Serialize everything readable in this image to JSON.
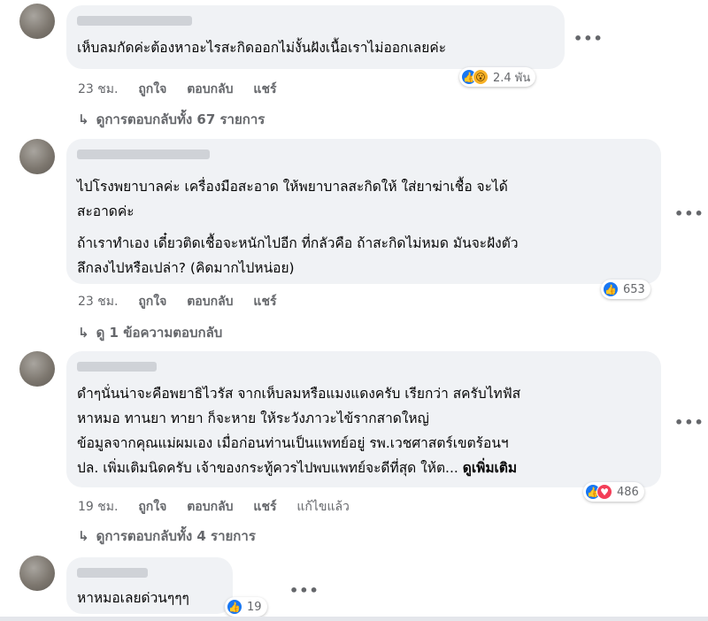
{
  "comments": [
    {
      "text_lines": [
        "เห็บลมกัดค่ะต้องหาอะไรสะกิดออกไม่งั้นฝังเนื้อเราไม่ออกเลยค่ะ"
      ],
      "time": "23 ชม.",
      "like_label": "ถูกใจ",
      "reply_label": "ตอบกลับ",
      "share_label": "แชร์",
      "reaction_count": "2.4 พัน",
      "reactions": [
        "like-icon",
        "wow-icon"
      ],
      "replies_label": "ดูการตอบกลับทั้ง 67 รายการ"
    },
    {
      "text_lines": [
        "ไปโรงพยาบาลค่ะ เครื่องมือสะอาด ให้พยาบาลสะกิดให้ ใส่ยาฆ่าเชื้อ จะได้",
        "สะอาดค่ะ",
        "ถ้าเราทำเอง เดี๋ยวติดเชื้อจะหนักไปอีก ที่กลัวคือ ถ้าสะกิดไม่หมด มันจะฝังตัว",
        "ลึกลงไปหรือเปล่า? (คิดมากไปหน่อย)"
      ],
      "time": "23 ชม.",
      "like_label": "ถูกใจ",
      "reply_label": "ตอบกลับ",
      "share_label": "แชร์",
      "reaction_count": "653",
      "reactions": [
        "like-icon"
      ],
      "replies_label": "ดู 1 ข้อความตอบกลับ"
    },
    {
      "text_lines": [
        "ดำๆนั่นน่าจะคือพยาธิไวรัส จากเห็บลมหรือแมงแดงครับ เรียกว่า สครับไทฟัส",
        "หาหมอ ทานยา ทายา ก็จะหาย ให้ระวังภาวะไข้รากสาดใหญ่",
        "ข้อมูลจากคุณแม่ผมเอง เมื่อก่อนท่านเป็นแพทย์อยู่ รพ.เวชศาสตร์เขตร้อนฯ",
        "ปล. เพิ่มเติมนิดครับ เจ้าของกระทู้ควรไปพบแพทย์จะดีที่สุด ให้ต..."
      ],
      "see_more": "ดูเพิ่มเติม",
      "time": "19 ชม.",
      "like_label": "ถูกใจ",
      "reply_label": "ตอบกลับ",
      "share_label": "แชร์",
      "edited_label": "แก้ไขแล้ว",
      "reaction_count": "486",
      "reactions": [
        "like-icon",
        "love-icon"
      ],
      "replies_label": "ดูการตอบกลับทั้ง 4 รายการ"
    },
    {
      "text_lines": [
        "หาหมอเลยด่วนๆๆๆ"
      ],
      "reaction_count": "19",
      "reactions": [
        "like-icon"
      ]
    }
  ],
  "more_glyph": "•••",
  "reply_arrow": "↳",
  "colors": {
    "like": "#1877f2",
    "love": "#f33e58",
    "wow": "#f7b125",
    "bubble": "#f0f2f5",
    "meta": "#65676b"
  }
}
